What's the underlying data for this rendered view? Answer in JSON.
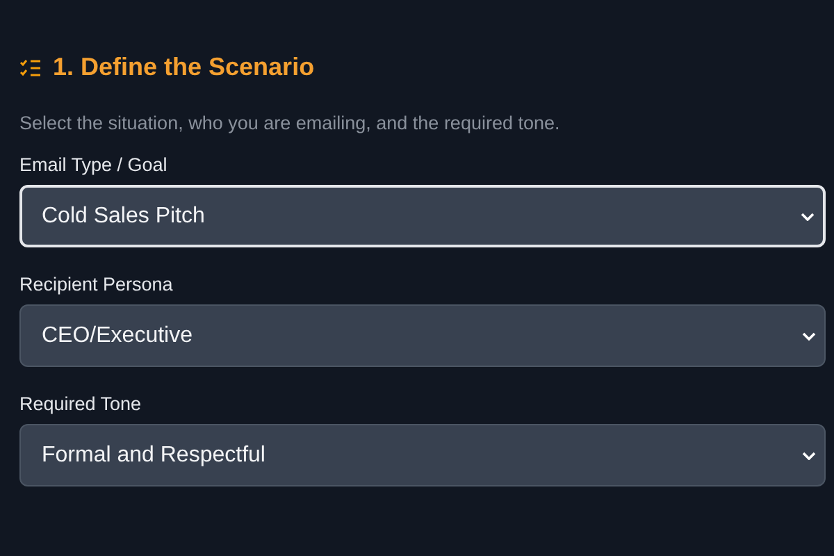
{
  "section": {
    "title": "1. Define the Scenario",
    "description": "Select the situation, who you are emailing, and the required tone."
  },
  "fields": [
    {
      "label": "Email Type / Goal",
      "value": "Cold Sales Pitch",
      "focused": true
    },
    {
      "label": "Recipient Persona",
      "value": "CEO/Executive",
      "focused": false
    },
    {
      "label": "Required Tone",
      "value": "Formal and Respectful",
      "focused": false
    }
  ]
}
